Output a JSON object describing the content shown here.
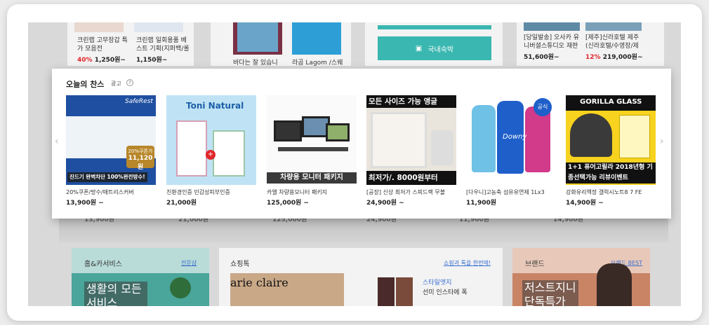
{
  "top_products": [
    {
      "name": "크린랩 고무장갑 특가 모음전",
      "discount": "40%",
      "price": "1,250원~"
    },
    {
      "name": "크린랩 일회용품 베스트 기획(지퍼백/롤",
      "price": "1,150원~"
    },
    {
      "name": "바다는 잘 있습니"
    },
    {
      "name": "라곰 Lagom /스웨"
    },
    {
      "button": "국내숙박"
    },
    {
      "name": "[당일발송] 오사카 유니버셜스튜디오 재판",
      "price": "51,600원~"
    },
    {
      "name": "[제주]신라호텔 제주(신라호텔/수영장/제",
      "discount": "12%",
      "price": "219,000원~"
    }
  ],
  "chance": {
    "title": "오늘의 찬스",
    "ad_label": "광고",
    "ad_help": "?",
    "prev": "‹",
    "next": "›",
    "items": [
      {
        "name": "20%쿠폰/방수/매트리스커버",
        "price": "13,900원 ~",
        "overlay": "진드기 완벽차단 100%완전방수!",
        "badge_top": "20%쿠폰가",
        "badge_price": "11,120원",
        "brand": "SafeRest"
      },
      {
        "name": "친환경인증 민감성피부인증",
        "price": "21,000원",
        "brand": "Toni Natural"
      },
      {
        "name": "카엘 차량용모니터 패키지",
        "price": "125,000원 ~",
        "overlay": "차량용 모니터 패키지"
      },
      {
        "name": "[공장] 신상 최저가 스피드랙 무볼",
        "price": "24,900원 ~",
        "overlay_top": "모든 사이즈 가능 앵글",
        "overlay": "최저가/. 8000원부터"
      },
      {
        "name": "[다우니]고농축 섬유유연제 1Lx3",
        "price": "11,900원",
        "badge": "공식",
        "brand": "Downy"
      },
      {
        "name": "강화유리액정 갤럭시노트8 7 FE",
        "price": "14,900원 ~",
        "overlay": "1+1 퓨어고릴라 2018년형 기종선택가능 리뷰이벤트",
        "brand": "GORILLA GLASS"
      }
    ],
    "below_prices": [
      "13,900원",
      "21,000원",
      "125,000원",
      "24,900원",
      "11,900원",
      "14,900원"
    ]
  },
  "sections": {
    "home": {
      "title": "홈&카서비스",
      "link": "전문샵",
      "banner": "생활의 모든 서비스"
    },
    "shopping": {
      "title": "쇼핑톡",
      "link": "쇼핑과 톡을 한번에!",
      "brand": "arie claire",
      "sub": "스타일엣지",
      "desc": "선미 인스타에 폭"
    },
    "brand": {
      "title": "브랜드",
      "link": "브랜드 BEST",
      "banner": "저스트지니 단독특가"
    }
  },
  "colors": {
    "teal": "#3ab7b0",
    "red": "#e0262b",
    "link": "#3a6fd0"
  }
}
